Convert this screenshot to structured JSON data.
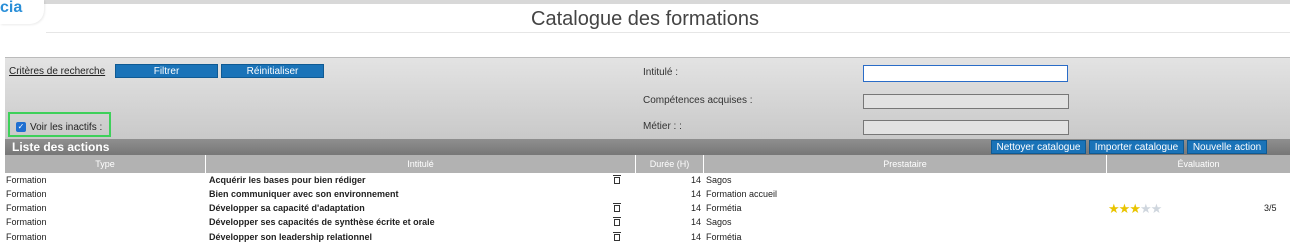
{
  "app": {
    "logo_text": "cia"
  },
  "page": {
    "title": "Catalogue des formations"
  },
  "filters": {
    "criteria_label": "Critères de recherche",
    "filter_button": "Filtrer",
    "reset_button": "Réinitialiser",
    "inactive_label": "Voir les inactifs :",
    "inactive_checked": true,
    "fields": {
      "intitule": {
        "label": "Intitulé :",
        "value": ""
      },
      "competences": {
        "label": "Compétences acquises :",
        "value": ""
      },
      "metier": {
        "label": "Métier : :",
        "value": ""
      }
    }
  },
  "list": {
    "title": "Liste des actions",
    "actions": {
      "clean": "Nettoyer catalogue",
      "import": "Importer catalogue",
      "new": "Nouvelle action"
    },
    "columns": [
      "Type",
      "Intitulé",
      "Durée (H)",
      "Prestataire",
      "Évaluation"
    ],
    "rows": [
      {
        "type": "Formation",
        "title": "Acquérir les bases pour bien rédiger",
        "duration": "14",
        "provider": "Sagos",
        "rating": ""
      },
      {
        "type": "Formation",
        "title": "Bien communiquer avec son environnement",
        "duration": "14",
        "provider": "Formation accueil",
        "rating": ""
      },
      {
        "type": "Formation",
        "title": "Développer sa capacité d'adaptation",
        "duration": "14",
        "provider": "Formétia",
        "rating": "3/5",
        "stars": 3
      },
      {
        "type": "Formation",
        "title": "Développer ses capacités de synthèse écrite et orale",
        "duration": "14",
        "provider": "Sagos",
        "rating": ""
      },
      {
        "type": "Formation",
        "title": "Développer son leadership relationnel",
        "duration": "14",
        "provider": "Formétia",
        "rating": ""
      }
    ]
  },
  "icons": {
    "delete": "trash-icon",
    "checkbox": "check-icon",
    "rating": "star-icon"
  },
  "colors": {
    "primary_button": "#1a73b8",
    "highlight_border": "#3ed05a",
    "star": "#e9c400"
  }
}
